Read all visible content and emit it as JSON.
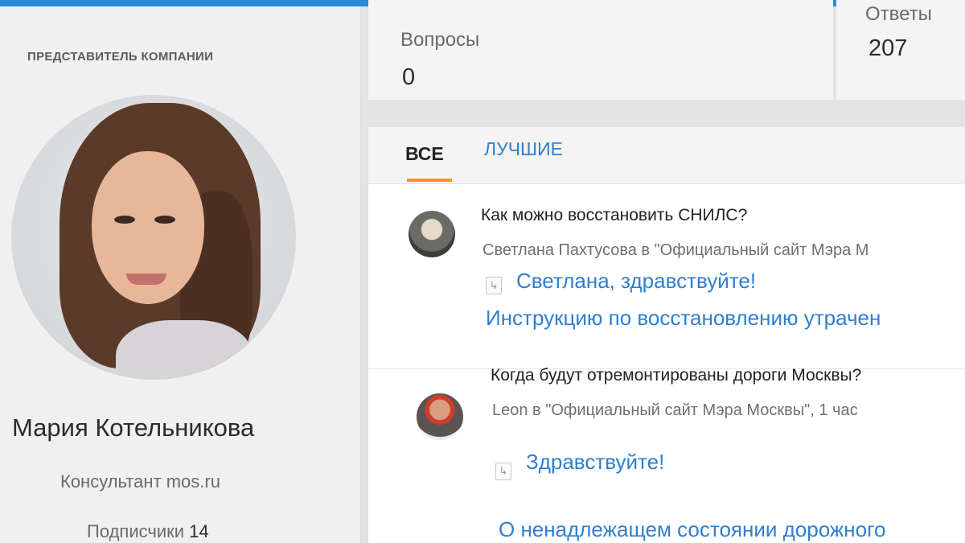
{
  "profile": {
    "role_label": "ПРЕДСТАВИТЕЛЬ КОМПАНИИ",
    "name": "Мария Котельникова",
    "position": "Консультант mos.ru",
    "subscribers_label": "Подписчики",
    "subscribers_count": "14"
  },
  "stats": {
    "questions_label": "Вопросы",
    "questions_value": "0",
    "answers_label": "Ответы",
    "answers_value": "207"
  },
  "tabs": [
    {
      "label": "ВСЕ",
      "active": true
    },
    {
      "label": "ЛУЧШИЕ",
      "active": false
    }
  ],
  "feed": [
    {
      "question": "Как можно восстановить СНИЛС?",
      "meta": "Светлана Пахтусова в \"Официальный сайт Мэра М",
      "reply_lines": [
        "Светлана, здравствуйте!",
        "Инструкцию по восстановлению утрачен"
      ]
    },
    {
      "question": "Когда будут отремонтированы дороги Москвы?",
      "meta": "Leon в \"Официальный сайт Мэра Москвы\", 1 час",
      "reply_lines": [
        "Здравствуйте!",
        "О ненадлежащем состоянии дорожного"
      ]
    }
  ],
  "icons": {
    "reply": "reply-arrow-icon"
  },
  "colors": {
    "accent_blue": "#2f7fcf",
    "tab_underline": "#f39a1e",
    "top_bar": "#2a8ad8"
  }
}
